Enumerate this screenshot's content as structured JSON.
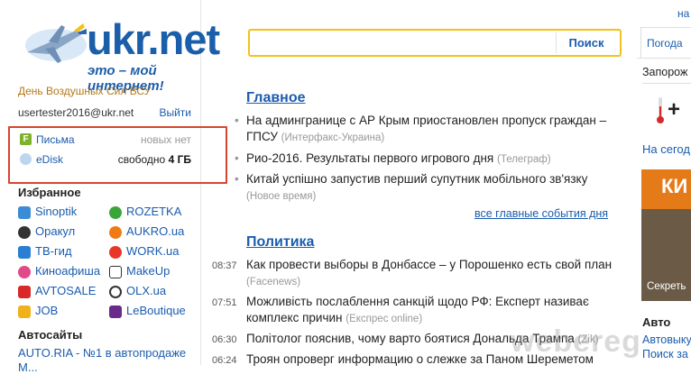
{
  "logo": {
    "brand": "ukr.net",
    "slogan": "это – мой интернет!"
  },
  "holiday_link": "День Воздушных Сил ВСУ",
  "user": {
    "email": "usertester2016@ukr.net",
    "logout": "Выйти"
  },
  "services": {
    "mail": {
      "label": "Письма",
      "status": "новых нет",
      "icon": "mail-f-icon"
    },
    "edisk": {
      "label": "eDisk",
      "free_prefix": "свободно",
      "free_value": "4 ГБ",
      "icon": "cloud-icon"
    }
  },
  "favorites": {
    "title": "Избранное",
    "left": [
      "Sinoptik",
      "Оракул",
      "ТВ-гид",
      "Киноафиша",
      "AVTOSALE",
      "JOB"
    ],
    "right": [
      "ROZETKA",
      "AUKRO.ua",
      "WORK.ua",
      "MakeUp",
      "OLX.ua",
      "LeBoutique"
    ]
  },
  "auto": {
    "title": "Автосайты",
    "line1": "AUTO.RIA - №1 в автопродаже",
    "line2": "М..."
  },
  "search": {
    "placeholder": "",
    "button": "Поиск"
  },
  "main_section": {
    "title": "Главное",
    "items": [
      {
        "text": "На админгранице с АР Крым приостановлен пропуск граждан – ГПСУ",
        "source": "(Интерфакс-Украина)"
      },
      {
        "text": "Рио-2016. Результаты первого игрового дня",
        "source": "(Телеграф)"
      },
      {
        "text": "Китай успішно запустив перший супутник мобільного зв'язку",
        "source": "(Новое время)"
      }
    ],
    "all_link": "все главные события дня"
  },
  "politics_section": {
    "title": "Политика",
    "items": [
      {
        "time": "08:37",
        "text": "Как провести выборы в Донбассе – у Порошенко есть свой план",
        "source": "(Facenews)"
      },
      {
        "time": "07:51",
        "text": "Можливість послаблення санкцій щодо РФ: Експерт називає комплекс причин",
        "source": "(Експрес online)"
      },
      {
        "time": "06:30",
        "text": "Політолог пояснив, чому варто боятися Дональда Трампа",
        "source": "(Zik)"
      },
      {
        "time": "06:24",
        "text": "Троян опроверг информацию о слежке за Паном Шереметом",
        "source": ""
      }
    ]
  },
  "right": {
    "top_link": "на",
    "tab": "Погода",
    "city": "Запорож",
    "temp": "+",
    "today": "На сегод",
    "promo_word": "КИ",
    "promo_caption": "Секреть",
    "auto_title": "Авто",
    "auto_line1": "Автовыку",
    "auto_line2": "Поиск за"
  },
  "watermark": "webereg"
}
